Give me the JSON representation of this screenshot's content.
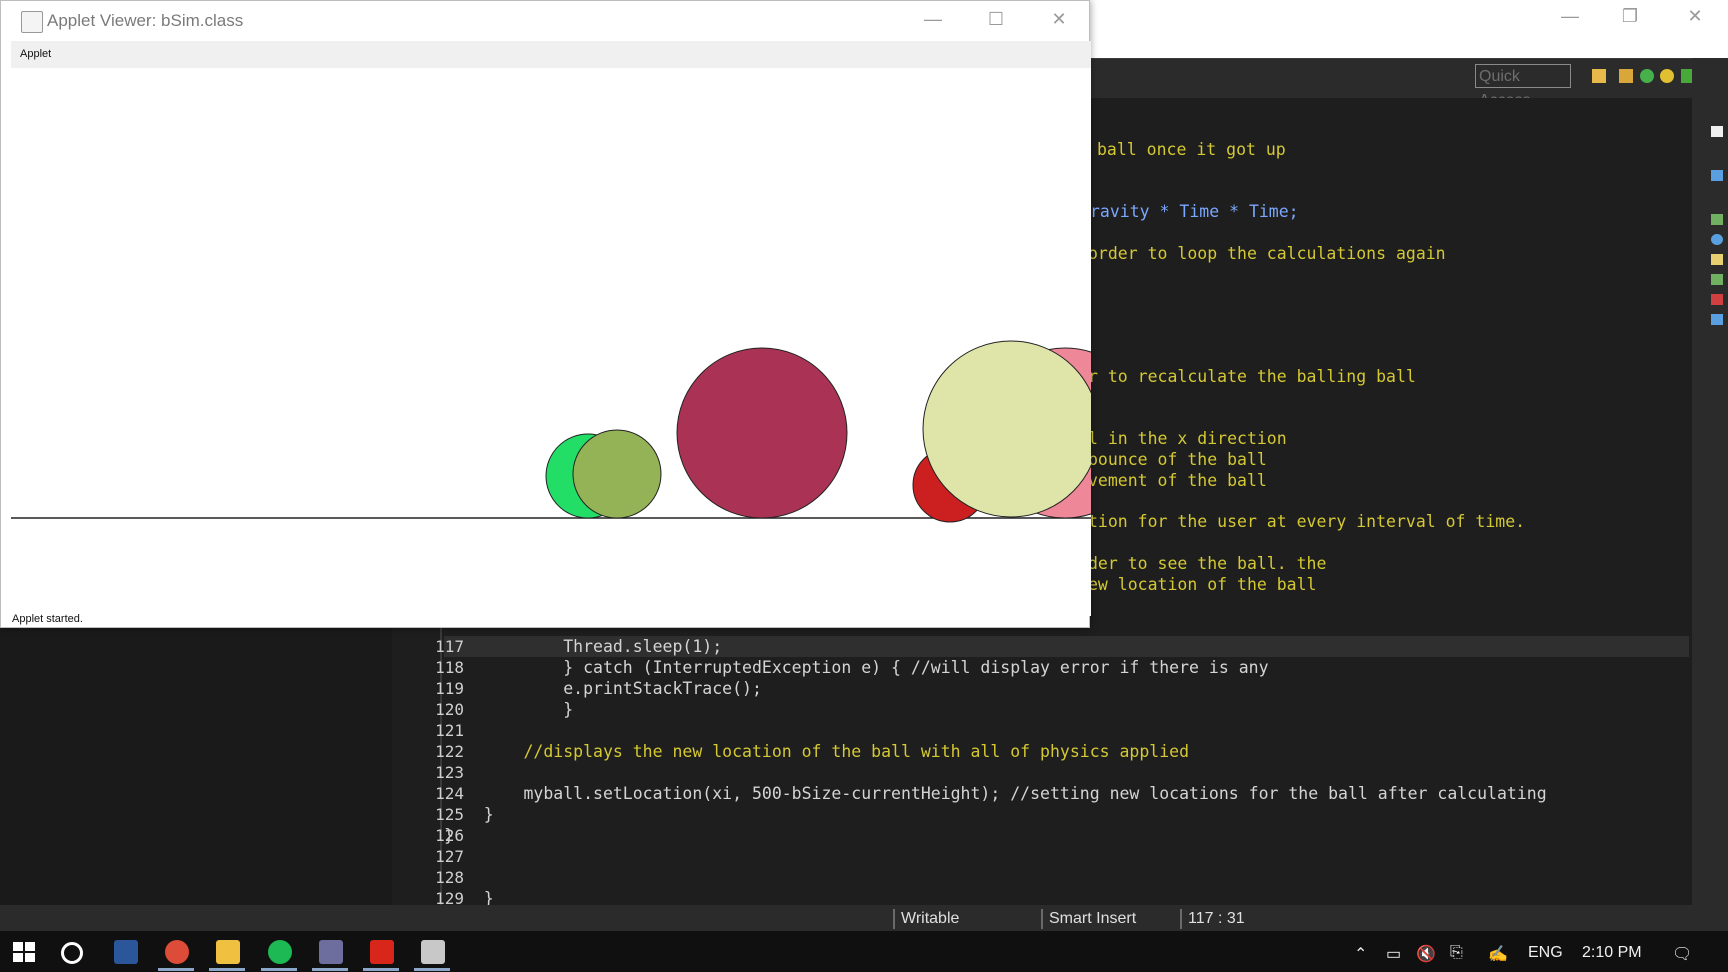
{
  "applet": {
    "title": "Applet Viewer: bSim.class",
    "menu": "Applet",
    "status": "Applet started.",
    "window_controls": {
      "minimize": "—",
      "maximize": "☐",
      "close": "✕"
    }
  },
  "eclipse": {
    "quick_access_placeholder": "Quick Access",
    "code_lines_right": [
      "ball once it got up",
      "ravity * Time * Time;",
      "order to loop the calculations again",
      "r to recalculate the balling ball",
      "l in the x direction",
      "bounce of the ball",
      "vement of the ball",
      "tion for the user at every interval of time.",
      "der to see the ball. the",
      "ew location of the ball"
    ],
    "code_lines": [
      {
        "num": "117",
        "text": "            Thread.sleep(1);"
      },
      {
        "num": "118",
        "text": "            } catch (InterruptedException e) { //will display error if there is any"
      },
      {
        "num": "119",
        "text": "            e.printStackTrace();"
      },
      {
        "num": "120",
        "text": "            }"
      },
      {
        "num": "121",
        "text": ""
      },
      {
        "num": "122",
        "text": "        //displays the new location of the ball with all of physics applied"
      },
      {
        "num": "123",
        "text": ""
      },
      {
        "num": "124",
        "text": "        myball.setLocation(xi, 500-bSize-currentHeight); //setting new locations for the ball after calculating"
      },
      {
        "num": "125",
        "text": "    }"
      },
      {
        "num": "126",
        "text": "}"
      },
      {
        "num": "127",
        "text": ""
      },
      {
        "num": "128",
        "text": ""
      },
      {
        "num": "129",
        "text": "    }"
      }
    ]
  },
  "statusbar": {
    "writable": "Writable",
    "insert_mode": "Smart Insert",
    "position": "117 : 31"
  },
  "taskbar": {
    "language": "ENG",
    "time": "2:10 PM"
  },
  "colors": {
    "ball_green": "#22dd66",
    "ball_olive": "#93b356",
    "ball_maroon": "#aa3355",
    "ball_red": "#cc1f1f",
    "ball_pink": "#ee8899",
    "ball_cream": "#dfe4a8"
  }
}
